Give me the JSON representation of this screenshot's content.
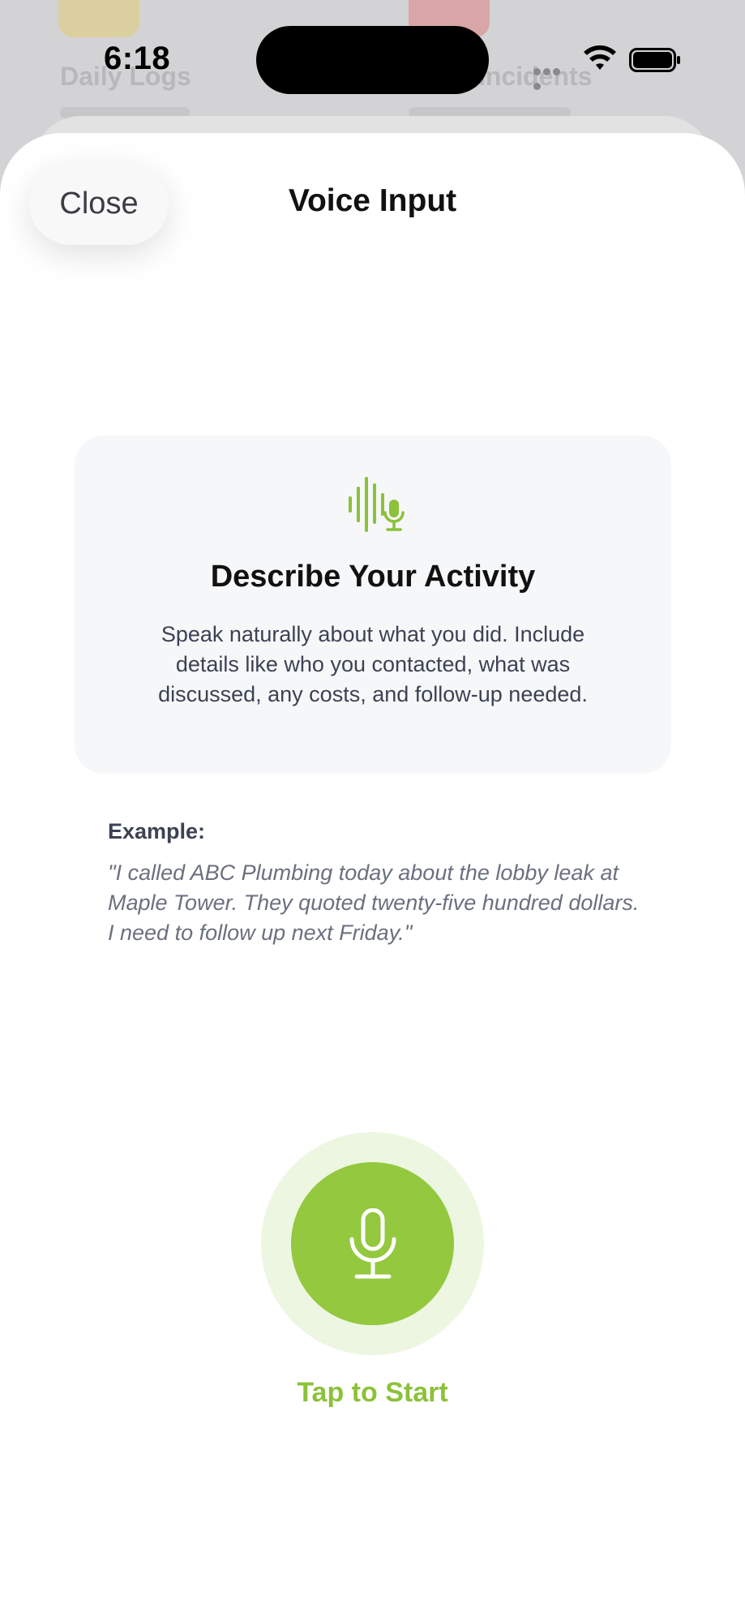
{
  "status_bar": {
    "time": "6:18"
  },
  "background_app": {
    "tile_left_label": "Daily Logs",
    "tile_right_label": "Incidents"
  },
  "sheet": {
    "close_label": "Close",
    "title": "Voice Input"
  },
  "info_card": {
    "icon": "waveform-mic-icon",
    "heading": "Describe Your Activity",
    "body": "Speak naturally about what you did. Include details like who you contacted, what was discussed, any costs, and follow-up needed."
  },
  "example": {
    "label": "Example:",
    "text": "\"I called ABC Plumbing today about the lobby leak at Maple Tower. They quoted twenty-five hundred dollars. I need to follow up next Friday.\""
  },
  "record": {
    "icon": "microphone-icon",
    "label": "Tap to Start"
  },
  "colors": {
    "accent": "#93c83f",
    "accent_text": "#8cc13a",
    "ring": "#edf6e1",
    "card_bg": "#f6f7f9"
  }
}
